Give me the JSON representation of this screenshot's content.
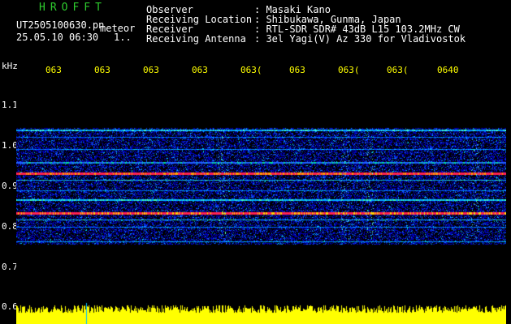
{
  "header": {
    "app_title": "HROFFT",
    "file_name": "UT2505100630.pn",
    "meteor_label": "meteor",
    "date_time": "25.05.10 06:30",
    "counter": "1.."
  },
  "info": [
    {
      "key": "Observer",
      "value": ": Masaki Kano"
    },
    {
      "key": "Receiving Location",
      "value": ": Shibukawa, Gunma, Japan"
    },
    {
      "key": "Receiver",
      "value": ": RTL-SDR SDR# 43dB L15 103.2MHz CW"
    },
    {
      "key": "Receiving Antenna",
      "value": ": 3el Yagi(V) Az 330 for Vladivostok"
    }
  ],
  "axis": {
    "y_unit": "kHz",
    "y_ticks": [
      "1.1",
      "1.0",
      "0.9",
      "0.8",
      "0.7",
      "0.6"
    ],
    "time_ticks": [
      "063",
      "063",
      "063",
      "063",
      "063(",
      "063",
      "063(",
      "063(",
      "0640"
    ]
  },
  "colors": {
    "background": "#000000",
    "title": "#2ecc2e",
    "time_ticks": "#ffff00",
    "signal_low": "#0000cc",
    "signal_mid": "#00c0ff",
    "signal_high": "#ff3060",
    "baseline": "#ffff00"
  }
}
